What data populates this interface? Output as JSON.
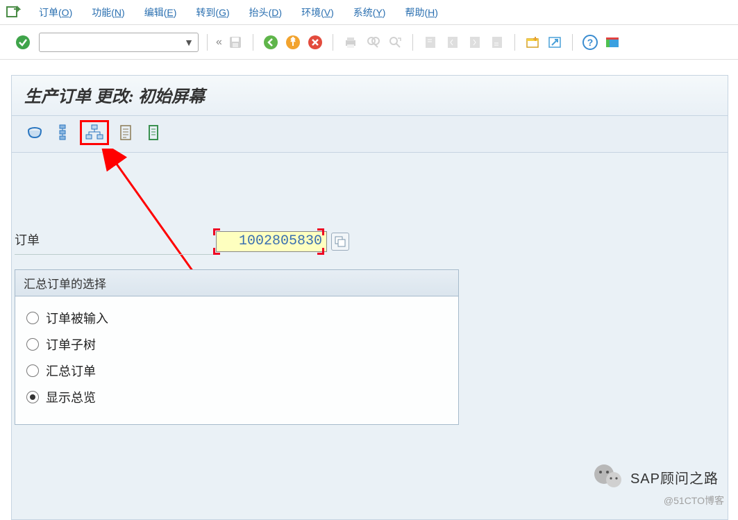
{
  "menu": {
    "items": [
      {
        "label": "订单",
        "key": "O"
      },
      {
        "label": "功能",
        "key": "N"
      },
      {
        "label": "编辑",
        "key": "E"
      },
      {
        "label": "转到",
        "key": "G"
      },
      {
        "label": "抬头",
        "key": "D"
      },
      {
        "label": "环境",
        "key": "V"
      },
      {
        "label": "系统",
        "key": "Y"
      },
      {
        "label": "帮助",
        "key": "H"
      }
    ]
  },
  "toolbar": {
    "combo_value": ""
  },
  "page": {
    "title": "生产订单 更改: 初始屏幕"
  },
  "form": {
    "order_label": "订单",
    "order_value": "1002805830"
  },
  "groupbox": {
    "title": "汇总订单的选择",
    "options": [
      {
        "label": "订单被输入",
        "checked": false
      },
      {
        "label": "订单子树",
        "checked": false
      },
      {
        "label": "汇总订单",
        "checked": false
      },
      {
        "label": "显示总览",
        "checked": true
      }
    ]
  },
  "footer": {
    "badge_text": "SAP顾问之路",
    "watermark": "@51CTO博客"
  }
}
